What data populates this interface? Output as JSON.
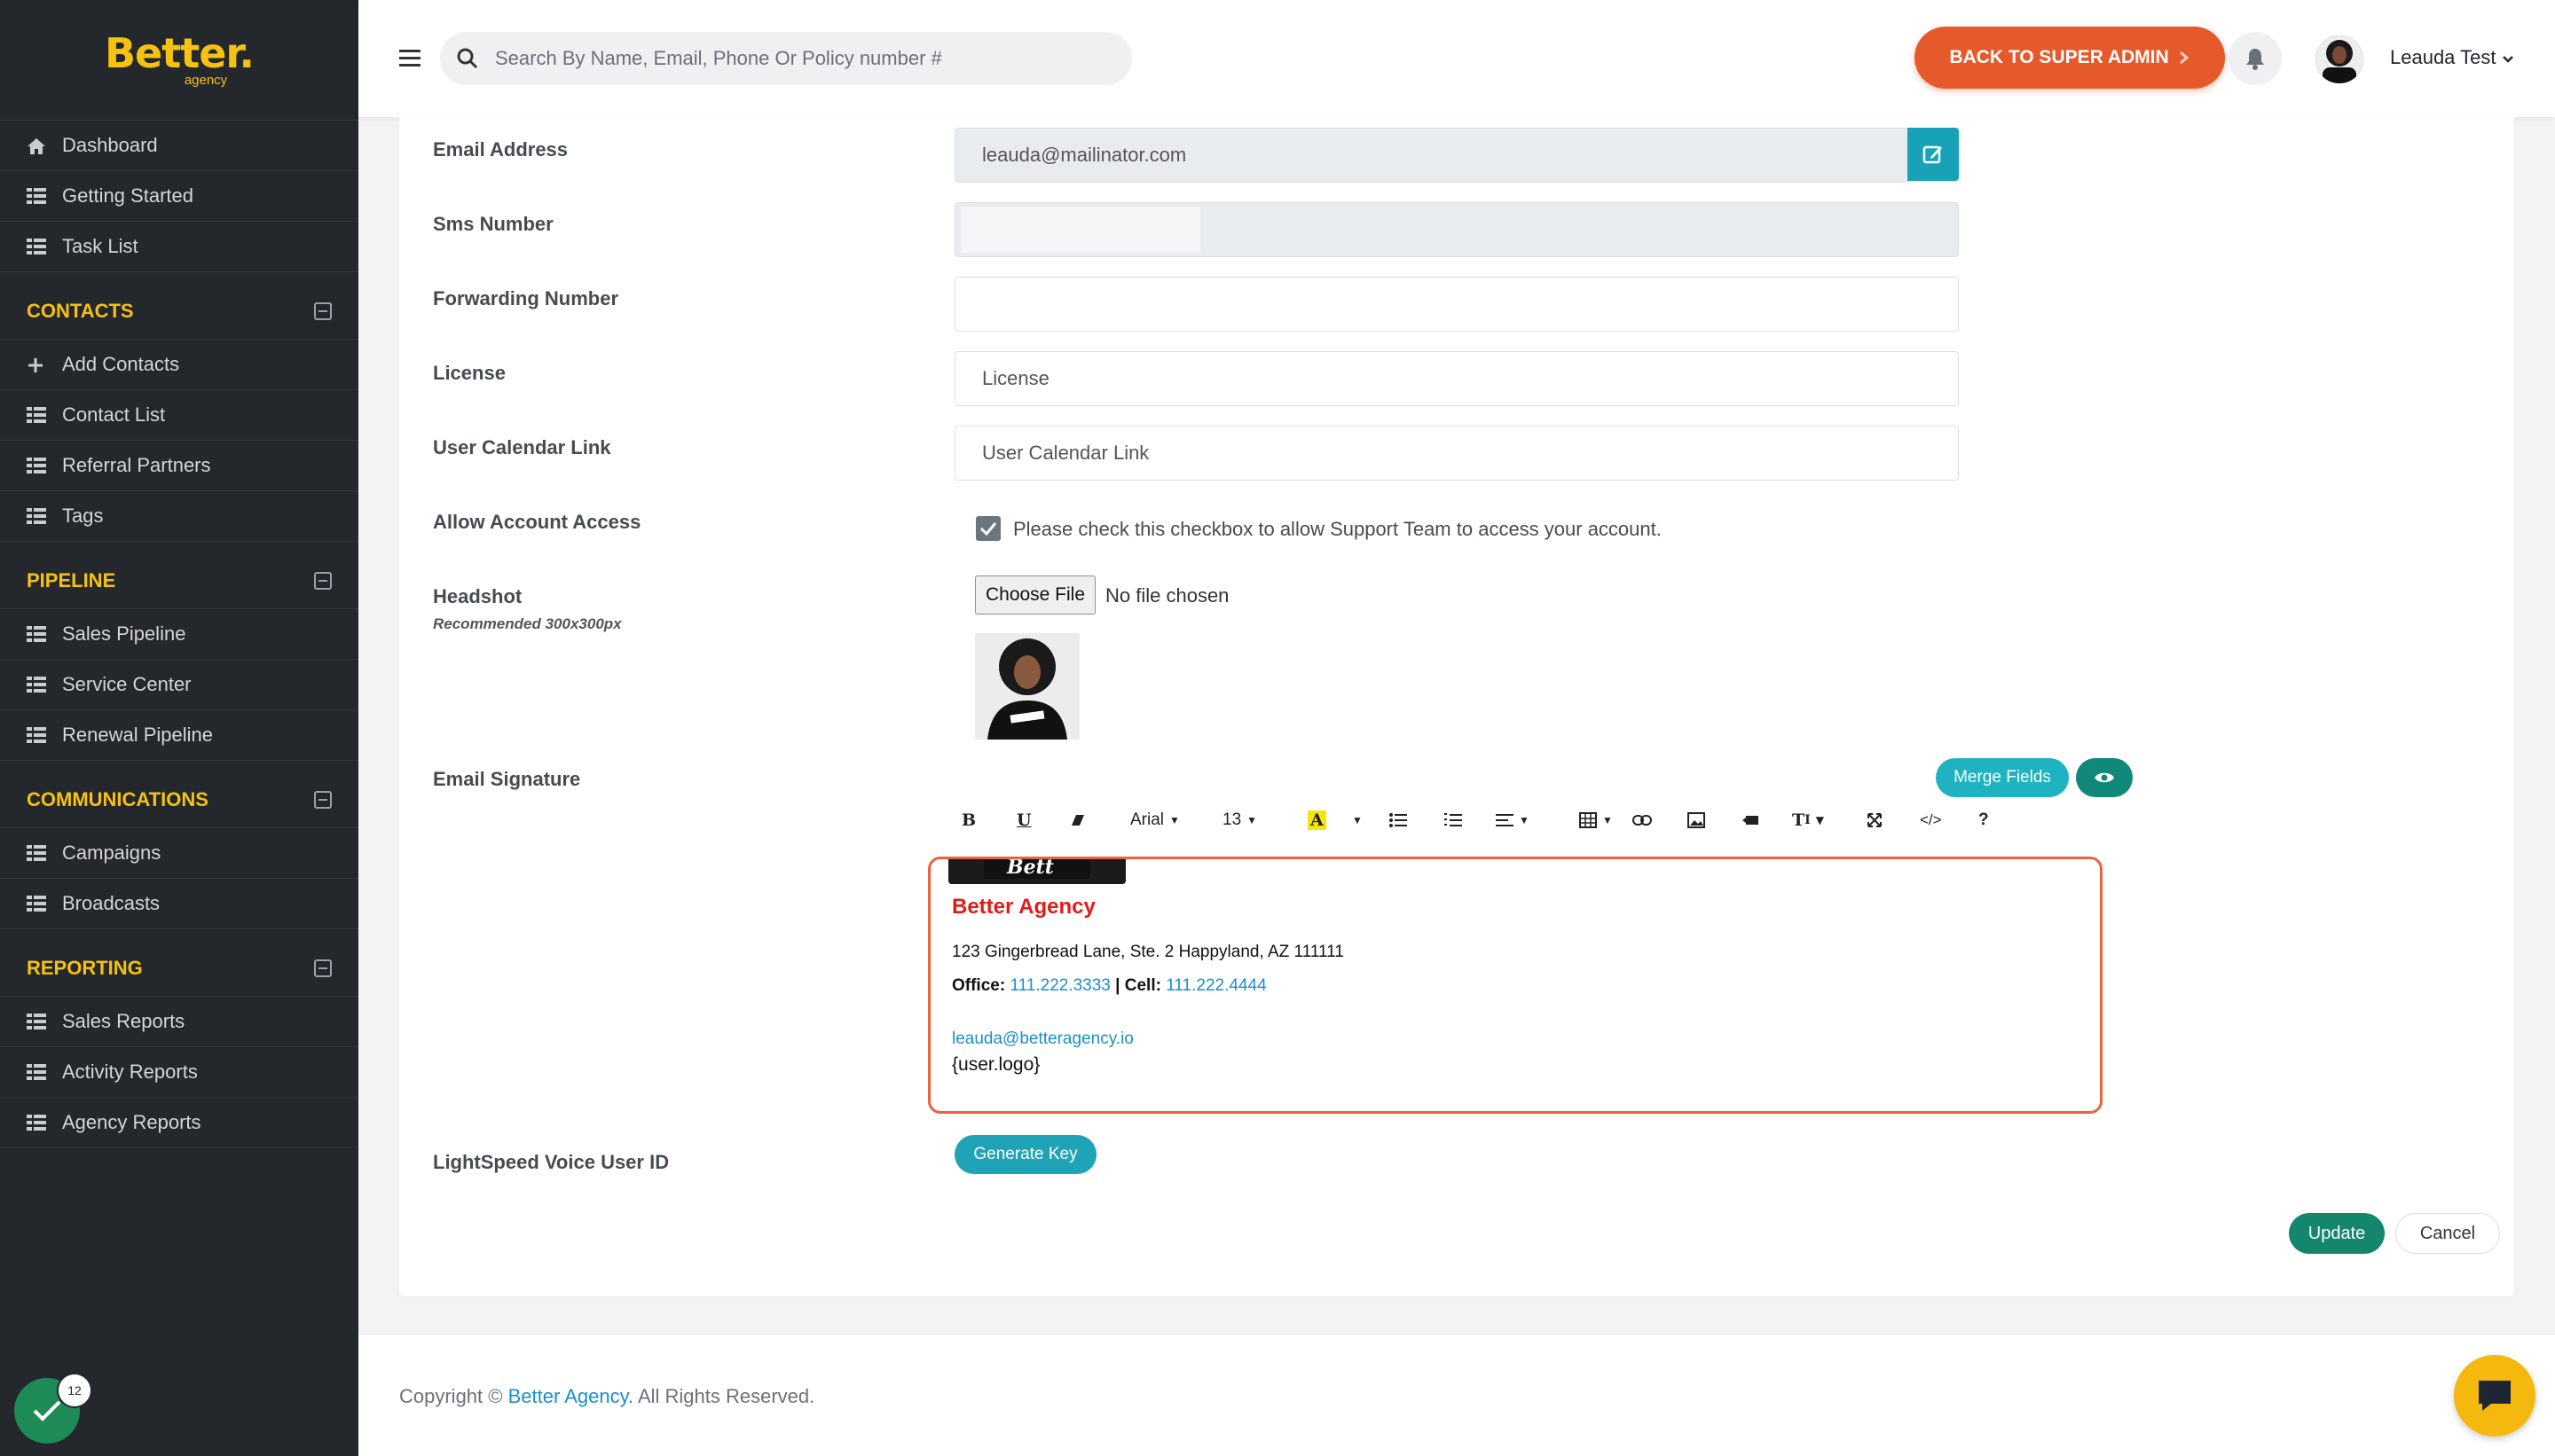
{
  "brand": {
    "name": "Better.",
    "sub": "agency"
  },
  "sidebar": {
    "top_items": [
      {
        "label": "Dashboard",
        "icon": "home-icon"
      },
      {
        "label": "Getting Started",
        "icon": "list-icon"
      },
      {
        "label": "Task List",
        "icon": "list-icon"
      }
    ],
    "sections": [
      {
        "title": "CONTACTS",
        "items": [
          "Add Contacts",
          "Contact List",
          "Referral Partners",
          "Tags"
        ]
      },
      {
        "title": "PIPELINE",
        "items": [
          "Sales Pipeline",
          "Service Center",
          "Renewal Pipeline"
        ]
      },
      {
        "title": "COMMUNICATIONS",
        "items": [
          "Campaigns",
          "Broadcasts"
        ]
      },
      {
        "title": "REPORTING",
        "items": [
          "Sales Reports",
          "Activity Reports",
          "Agency Reports"
        ]
      }
    ],
    "badge_count": "12"
  },
  "topbar": {
    "search_placeholder": "Search By Name, Email, Phone Or Policy number #",
    "admin_button": "BACK TO SUPER ADMIN",
    "user_name": "Leauda Test"
  },
  "form": {
    "email_label": "Email Address",
    "email_value": "leauda@mailinator.com",
    "sms_label": "Sms Number",
    "forwarding_label": "Forwarding Number",
    "license_label": "License",
    "license_placeholder": "License",
    "calendar_label": "User Calendar Link",
    "calendar_placeholder": "User Calendar Link",
    "access_label": "Allow Account Access",
    "access_text": "Please check this checkbox to allow Support Team to access your account.",
    "headshot_label": "Headshot",
    "headshot_sub": "Recommended 300x300px",
    "file_button": "Choose File",
    "file_status": "No file chosen",
    "signature_label": "Email Signature",
    "merge_button": "Merge Fields",
    "voice_label": "LightSpeed Voice User ID",
    "generate_button": "Generate Key",
    "update_button": "Update",
    "cancel_button": "Cancel"
  },
  "toolbar": {
    "font_name": "Arial",
    "font_size": "13"
  },
  "signature": {
    "agency": "Better Agency",
    "address": "123 Gingerbread Lane, Ste. 2 Happyland, AZ 111111",
    "office_label": "Office",
    "office_phone": "111.222.3333",
    "cell_label": "Cell:",
    "cell_phone": "111.222.4444",
    "email": "leauda@betteragency.io",
    "logo_tag": "{user.logo}"
  },
  "footer": {
    "prefix": "Copyright ©",
    "link": "Better Agency",
    "suffix": ". All Rights Reserved."
  },
  "colors": {
    "accent": "#e6592a",
    "brand_yellow": "#f5c211",
    "teal": "#17a2b8",
    "sidebar": "#24272b"
  }
}
